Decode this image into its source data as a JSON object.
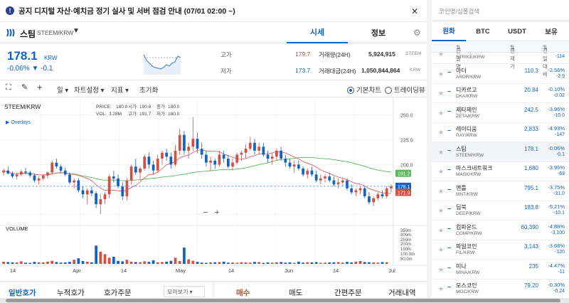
{
  "notice": {
    "text": "공지 디지털 자산·예치금 정기 실사 및 서버 점검 안내 (07/01 02:00 ~)"
  },
  "coin": {
    "name": "스팀",
    "pair": "STEEM/KRW"
  },
  "tabs": [
    "시세",
    "정보"
  ],
  "price": {
    "value": "178.1",
    "unit": "KRW",
    "change_rate": "-0.06%",
    "change_abs": "▼ -0.1"
  },
  "stats": {
    "high_label": "고가",
    "high": "179.7",
    "low_label": "저가",
    "low": "173.7",
    "vol_label": "거래량(24H)",
    "vol": "5,924,915",
    "vol_unit": "STEEM",
    "amt_label": "거래대금(24H)",
    "amt": "1,050,844,864",
    "amt_unit": "KRW"
  },
  "toolbar": {
    "interval": "일",
    "chart_settings": "차트설정",
    "indicator": "지표",
    "reset": "초기화",
    "basic_chart": "기본차트",
    "tradingview": "트레이딩뷰"
  },
  "chart_data": {
    "type": "candlestick",
    "symbol": "STEEM/KRW",
    "legend": {
      "price": "PRICE:",
      "open_label": "시가:",
      "high_label": "고가:",
      "close_label": "종가:",
      "low_label": "저가:",
      "vol_label": "VOL:",
      "p_open": "180.0",
      "p_open2": "190.6",
      "p_high": "180.0",
      "vol": "3.28M",
      "p_low": "191.7",
      "p_close": "180.0"
    },
    "overlays_label": "Overlays",
    "y_ticks": [
      250.0,
      225.0,
      200.0
    ],
    "ylim": [
      140,
      262
    ],
    "last_price_tag": "178.1",
    "ma_tag_green": "191.2",
    "ma_tag_red": "171.9",
    "volume_label": "VOLUME",
    "volume_ticks": [
      "350m",
      "300m",
      "250m",
      "200m",
      "150m",
      "100.0m",
      "50.0m"
    ],
    "x_labels": [
      "14",
      "Apr",
      "14",
      "May",
      "14",
      "Jun",
      "14",
      "Jul"
    ],
    "candles": [
      [
        192,
        196,
        189,
        194
      ],
      [
        194,
        198,
        190,
        191
      ],
      [
        191,
        193,
        186,
        188
      ],
      [
        188,
        192,
        185,
        190
      ],
      [
        190,
        195,
        188,
        193
      ],
      [
        193,
        197,
        190,
        192
      ],
      [
        192,
        194,
        187,
        189
      ],
      [
        189,
        191,
        182,
        184
      ],
      [
        184,
        188,
        180,
        186
      ],
      [
        186,
        190,
        184,
        189
      ],
      [
        189,
        193,
        186,
        192
      ],
      [
        192,
        204,
        190,
        202
      ],
      [
        202,
        206,
        196,
        198
      ],
      [
        198,
        200,
        192,
        194
      ],
      [
        194,
        197,
        188,
        190
      ],
      [
        190,
        192,
        180,
        182
      ],
      [
        182,
        186,
        176,
        184
      ],
      [
        184,
        186,
        172,
        174
      ],
      [
        174,
        178,
        166,
        170
      ],
      [
        170,
        176,
        160,
        174
      ],
      [
        174,
        178,
        168,
        171
      ],
      [
        171,
        173,
        156,
        160
      ],
      [
        160,
        170,
        150,
        165
      ],
      [
        165,
        172,
        160,
        170
      ],
      [
        170,
        190,
        166,
        188
      ],
      [
        188,
        194,
        182,
        186
      ],
      [
        186,
        190,
        176,
        178
      ],
      [
        178,
        182,
        164,
        168
      ],
      [
        168,
        186,
        164,
        184
      ],
      [
        184,
        200,
        180,
        198
      ],
      [
        198,
        206,
        190,
        192
      ],
      [
        192,
        198,
        184,
        196
      ],
      [
        196,
        210,
        194,
        208
      ],
      [
        208,
        212,
        196,
        200
      ],
      [
        200,
        204,
        190,
        194
      ],
      [
        194,
        210,
        192,
        206
      ],
      [
        206,
        214,
        200,
        212
      ],
      [
        212,
        216,
        204,
        208
      ],
      [
        208,
        212,
        196,
        200
      ],
      [
        200,
        220,
        198,
        214
      ],
      [
        214,
        236,
        210,
        230
      ],
      [
        230,
        234,
        210,
        214
      ],
      [
        214,
        222,
        206,
        218
      ],
      [
        218,
        248,
        214,
        226
      ],
      [
        226,
        232,
        212,
        216
      ],
      [
        216,
        222,
        206,
        210
      ],
      [
        210,
        214,
        198,
        202
      ],
      [
        202,
        208,
        194,
        204
      ],
      [
        204,
        206,
        196,
        200
      ],
      [
        200,
        214,
        198,
        210
      ],
      [
        210,
        214,
        202,
        206
      ],
      [
        206,
        210,
        196,
        198
      ],
      [
        198,
        206,
        194,
        202
      ],
      [
        202,
        212,
        200,
        210
      ],
      [
        210,
        214,
        204,
        212
      ],
      [
        212,
        220,
        206,
        216
      ],
      [
        216,
        228,
        214,
        222
      ],
      [
        222,
        226,
        210,
        214
      ],
      [
        214,
        222,
        210,
        218
      ],
      [
        218,
        222,
        208,
        210
      ],
      [
        210,
        214,
        202,
        206
      ],
      [
        206,
        212,
        200,
        208
      ],
      [
        208,
        216,
        204,
        214
      ],
      [
        214,
        218,
        204,
        206
      ],
      [
        206,
        210,
        198,
        202
      ],
      [
        202,
        206,
        196,
        198
      ],
      [
        198,
        204,
        192,
        200
      ],
      [
        200,
        204,
        194,
        196
      ],
      [
        196,
        198,
        188,
        190
      ],
      [
        190,
        196,
        186,
        194
      ],
      [
        194,
        198,
        188,
        190
      ],
      [
        190,
        194,
        182,
        184
      ],
      [
        184,
        190,
        180,
        186
      ],
      [
        186,
        190,
        182,
        188
      ],
      [
        188,
        192,
        182,
        184
      ],
      [
        184,
        188,
        178,
        180
      ],
      [
        180,
        186,
        176,
        182
      ],
      [
        182,
        186,
        178,
        184
      ],
      [
        184,
        186,
        174,
        176
      ],
      [
        176,
        180,
        170,
        172
      ],
      [
        172,
        176,
        168,
        174
      ],
      [
        174,
        178,
        170,
        176
      ],
      [
        176,
        178,
        166,
        168
      ],
      [
        168,
        172,
        160,
        162
      ],
      [
        162,
        168,
        158,
        166
      ],
      [
        166,
        172,
        164,
        170
      ],
      [
        170,
        174,
        166,
        168
      ],
      [
        168,
        178,
        166,
        176
      ],
      [
        176,
        180,
        172,
        178
      ]
    ],
    "volumes": [
      22,
      18,
      15,
      14,
      25,
      12,
      10,
      20,
      16,
      14,
      22,
      30,
      18,
      12,
      14,
      20,
      40,
      55,
      28,
      22,
      15,
      180,
      120,
      95,
      60,
      70,
      30,
      25,
      40,
      22,
      18,
      16,
      25,
      20,
      35,
      15,
      18,
      22,
      30,
      60,
      28,
      160,
      45,
      30,
      20,
      12,
      10,
      14,
      16,
      18,
      22,
      12,
      14,
      10,
      16,
      14,
      12,
      20,
      18,
      10,
      14,
      12,
      16,
      18,
      12,
      14,
      10,
      22,
      12,
      16,
      14,
      18,
      10,
      12,
      14,
      16,
      18,
      12,
      20,
      14,
      22,
      28,
      18,
      16,
      14,
      12,
      18,
      16
    ],
    "ma_green_start": 160,
    "ma_green_end": 191.2
  },
  "bottom": {
    "tabs": [
      "일반호가",
      "누적호가",
      "호가주문"
    ],
    "view": "모아보기",
    "trade_tabs": [
      "매수",
      "매도",
      "간편주문",
      "거래내역"
    ]
  },
  "side": {
    "search_placeholder": "코인명/심볼검색",
    "tabs": [
      "원화",
      "BTC",
      "USDT",
      "보유"
    ],
    "headers": [
      "한글명",
      "현재가",
      "전일대비"
    ],
    "coins": [
      {
        "name": "스트라이크",
        "pair": "STRIKE/KRW",
        "price": "",
        "rate": "",
        "abs": "-114"
      },
      {
        "name": "아더",
        "pair": "ARDR/KRW",
        "price": "110.3",
        "rate": "-2.56%",
        "abs": "-2.9"
      },
      {
        "name": "디카르고",
        "pair": "DKA/KRW",
        "price": "20.84",
        "rate": "-0.10%",
        "abs": "-0.02"
      },
      {
        "name": "제타체인",
        "pair": "ZETA/KRW",
        "price": "242.5",
        "rate": "-3.96%",
        "abs": "-10.0"
      },
      {
        "name": "레이디움",
        "pair": "RAY/KRW",
        "price": "2,833",
        "rate": "-4.93%",
        "abs": "-147"
      },
      {
        "name": "스팀",
        "pair": "STEEM/KRW",
        "price": "178.1",
        "rate": "-0.06%",
        "abs": "-0.1"
      },
      {
        "name": "마스크네트워크",
        "pair": "MASK/KRW",
        "price": "1,680",
        "rate": "-3.95%",
        "abs": "-69"
      },
      {
        "name": "맨틀",
        "pair": "MNT/KRW",
        "price": "795.1",
        "rate": "-3.75%",
        "abs": "-31.0"
      },
      {
        "name": "딥북",
        "pair": "DEEP/KRW",
        "price": "183.8",
        "rate": "-5.21%",
        "abs": "-10.1"
      },
      {
        "name": "컴파운드",
        "pair": "COMP/KRW",
        "price": "60,390",
        "rate": "-4.88%",
        "abs": "-3,100"
      },
      {
        "name": "파일코인",
        "pair": "FIL/KRW",
        "price": "3,143",
        "rate": "-3.68%",
        "abs": "-120"
      },
      {
        "name": "미나",
        "pair": "MINA/KRW",
        "price": "235",
        "rate": "-4.47%",
        "abs": "-11"
      },
      {
        "name": "모스코인",
        "pair": "MOC/KRW",
        "price": "79.20",
        "rate": "-0.30%",
        "abs": "-0.24"
      }
    ]
  }
}
